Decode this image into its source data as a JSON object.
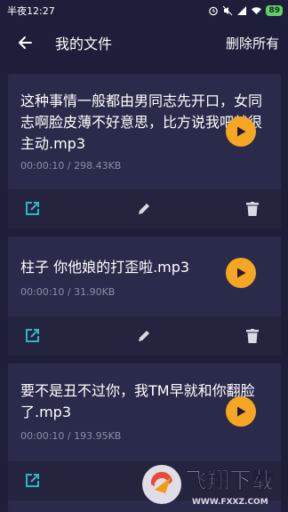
{
  "status_bar": {
    "time": "半夜12:27",
    "battery": "89"
  },
  "app_bar": {
    "title": "我的文件",
    "delete_all": "删除所有"
  },
  "files": [
    {
      "name": "这种事情一般都由男同志先开口，女同志啊脸皮薄不好意思，比方说我吧就很主动.mp3",
      "meta": "00:00:10 / 298.43KB"
    },
    {
      "name": "柱子 你他娘的打歪啦.mp3",
      "meta": "00:00:10 / 31.90KB"
    },
    {
      "name": "要不是丑不过你，我TM早就和你翻脸了.mp3",
      "meta": "00:00:10 / 193.95KB"
    }
  ],
  "watermark": {
    "text": "飞翔下载",
    "url": "WWW.FXXZ.COM"
  },
  "colors": {
    "background": "#1e1e3b",
    "card": "#2a2a4a",
    "accent_play": "#f6a623",
    "share_icon": "#2bb5c8"
  }
}
